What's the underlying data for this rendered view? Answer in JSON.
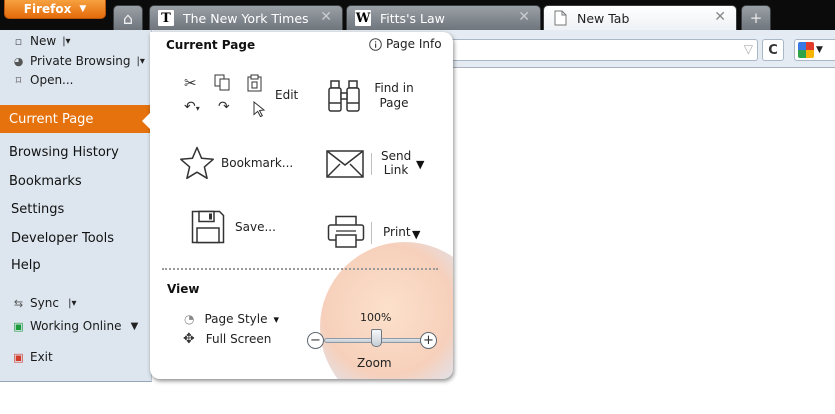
{
  "browser": {
    "app_button_label": "Firefox",
    "tabs": [
      {
        "title": "The New York Times",
        "favicon_char": "T"
      },
      {
        "title": "Fitts's Law",
        "favicon_char": "W"
      },
      {
        "title": "New Tab",
        "favicon_char": ""
      }
    ],
    "close_glyph": "✕",
    "add_tab_glyph": "+",
    "home_glyph": "⌂",
    "url_value": "",
    "reload_glyph": "C"
  },
  "app_menu": {
    "top_items": [
      {
        "label": "New",
        "icon": "new-window-icon",
        "has_dropdown": true
      },
      {
        "label": "Private Browsing",
        "icon": "mask-icon",
        "has_dropdown": true
      },
      {
        "label": "Open...",
        "icon": "folder-icon",
        "has_dropdown": false
      }
    ],
    "main_items": [
      {
        "label": "Current Page"
      },
      {
        "label": "Browsing History"
      },
      {
        "label": "Bookmarks"
      },
      {
        "label": "Settings"
      },
      {
        "label": "Developer Tools"
      },
      {
        "label": "Help"
      }
    ],
    "bottom_items": [
      {
        "label": "Sync",
        "icon": "sync-icon"
      },
      {
        "label": "Working Online",
        "icon": "network-icon"
      },
      {
        "label": "Exit",
        "icon": "exit-icon"
      }
    ]
  },
  "panel": {
    "title": "Current Page",
    "page_info_label": "Page Info",
    "edit_label": "Edit",
    "find_label_1": "Find in",
    "find_label_2": "Page",
    "bookmark_label": "Bookmark...",
    "send_label_1": "Send",
    "send_label_2": "Link",
    "save_label": "Save...",
    "print_label": "Print",
    "view_title": "View",
    "page_style_label": "Page Style",
    "full_screen_label": "Full Screen",
    "zoom_label": "Zoom",
    "zoom_value": "100%",
    "zoom_fraction": 0.5
  }
}
